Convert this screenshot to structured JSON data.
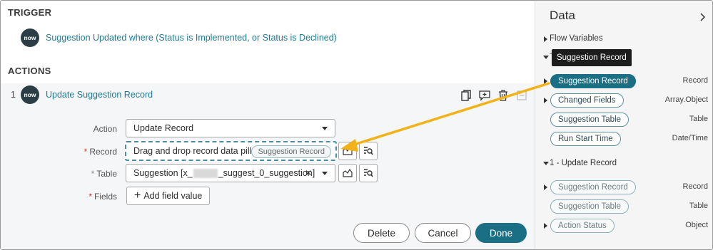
{
  "trigger": {
    "heading": "TRIGGER",
    "logo": "now",
    "summary": "Suggestion Updated where (Status is Implemented, or Status is Declined)"
  },
  "actions": {
    "heading": "ACTIONS",
    "step_number": "1",
    "logo": "now",
    "step_name": "Update Suggestion Record",
    "toolbar_icons": [
      "copy-icon",
      "add-comment-icon",
      "trash-icon",
      "collapse-icon"
    ]
  },
  "form": {
    "action": {
      "label": "Action",
      "value": "Update Record"
    },
    "record": {
      "label": "Record",
      "required_mark": "*",
      "drop_text": "Drag and drop record data pill",
      "dragged_pill": "Suggestion Record"
    },
    "table": {
      "label": "Table",
      "optional_mark": "*",
      "value_prefix": "Suggestion [x_",
      "value_suffix": "_suggest_0_suggestion]",
      "clear_glyph": "✕"
    },
    "fields": {
      "label": "Fields",
      "required_mark": "*",
      "add_label": "Add field value",
      "add_glyph": "+"
    }
  },
  "buttons": {
    "delete": "Delete",
    "cancel": "Cancel",
    "done": "Done"
  },
  "data_panel": {
    "title": "Data",
    "tooltip": "Suggestion Record",
    "flow_variables": "Flow Variables",
    "trigger_group_prefix": "T",
    "trigger_group_suffix": "d",
    "trigger_items": [
      {
        "name": "Suggestion Record",
        "type": "Record",
        "expandable": true
      },
      {
        "name": "Changed Fields",
        "type": "Array.Object",
        "expandable": true
      },
      {
        "name": "Suggestion Table",
        "type": "Table",
        "expandable": false
      },
      {
        "name": "Run Start Time",
        "type": "Date/Time",
        "expandable": false
      }
    ],
    "action_group": "1 - Update Record",
    "action_items": [
      {
        "name": "Suggestion Record",
        "type": "Record",
        "expandable": true
      },
      {
        "name": "Suggestion Table",
        "type": "Table",
        "expandable": false
      },
      {
        "name": "Action Status",
        "type": "Object",
        "expandable": true
      }
    ]
  },
  "colors": {
    "accent": "#1b6f85",
    "link": "#1f7a93",
    "arrow": "#f2b21a",
    "required": "#c7342b"
  }
}
